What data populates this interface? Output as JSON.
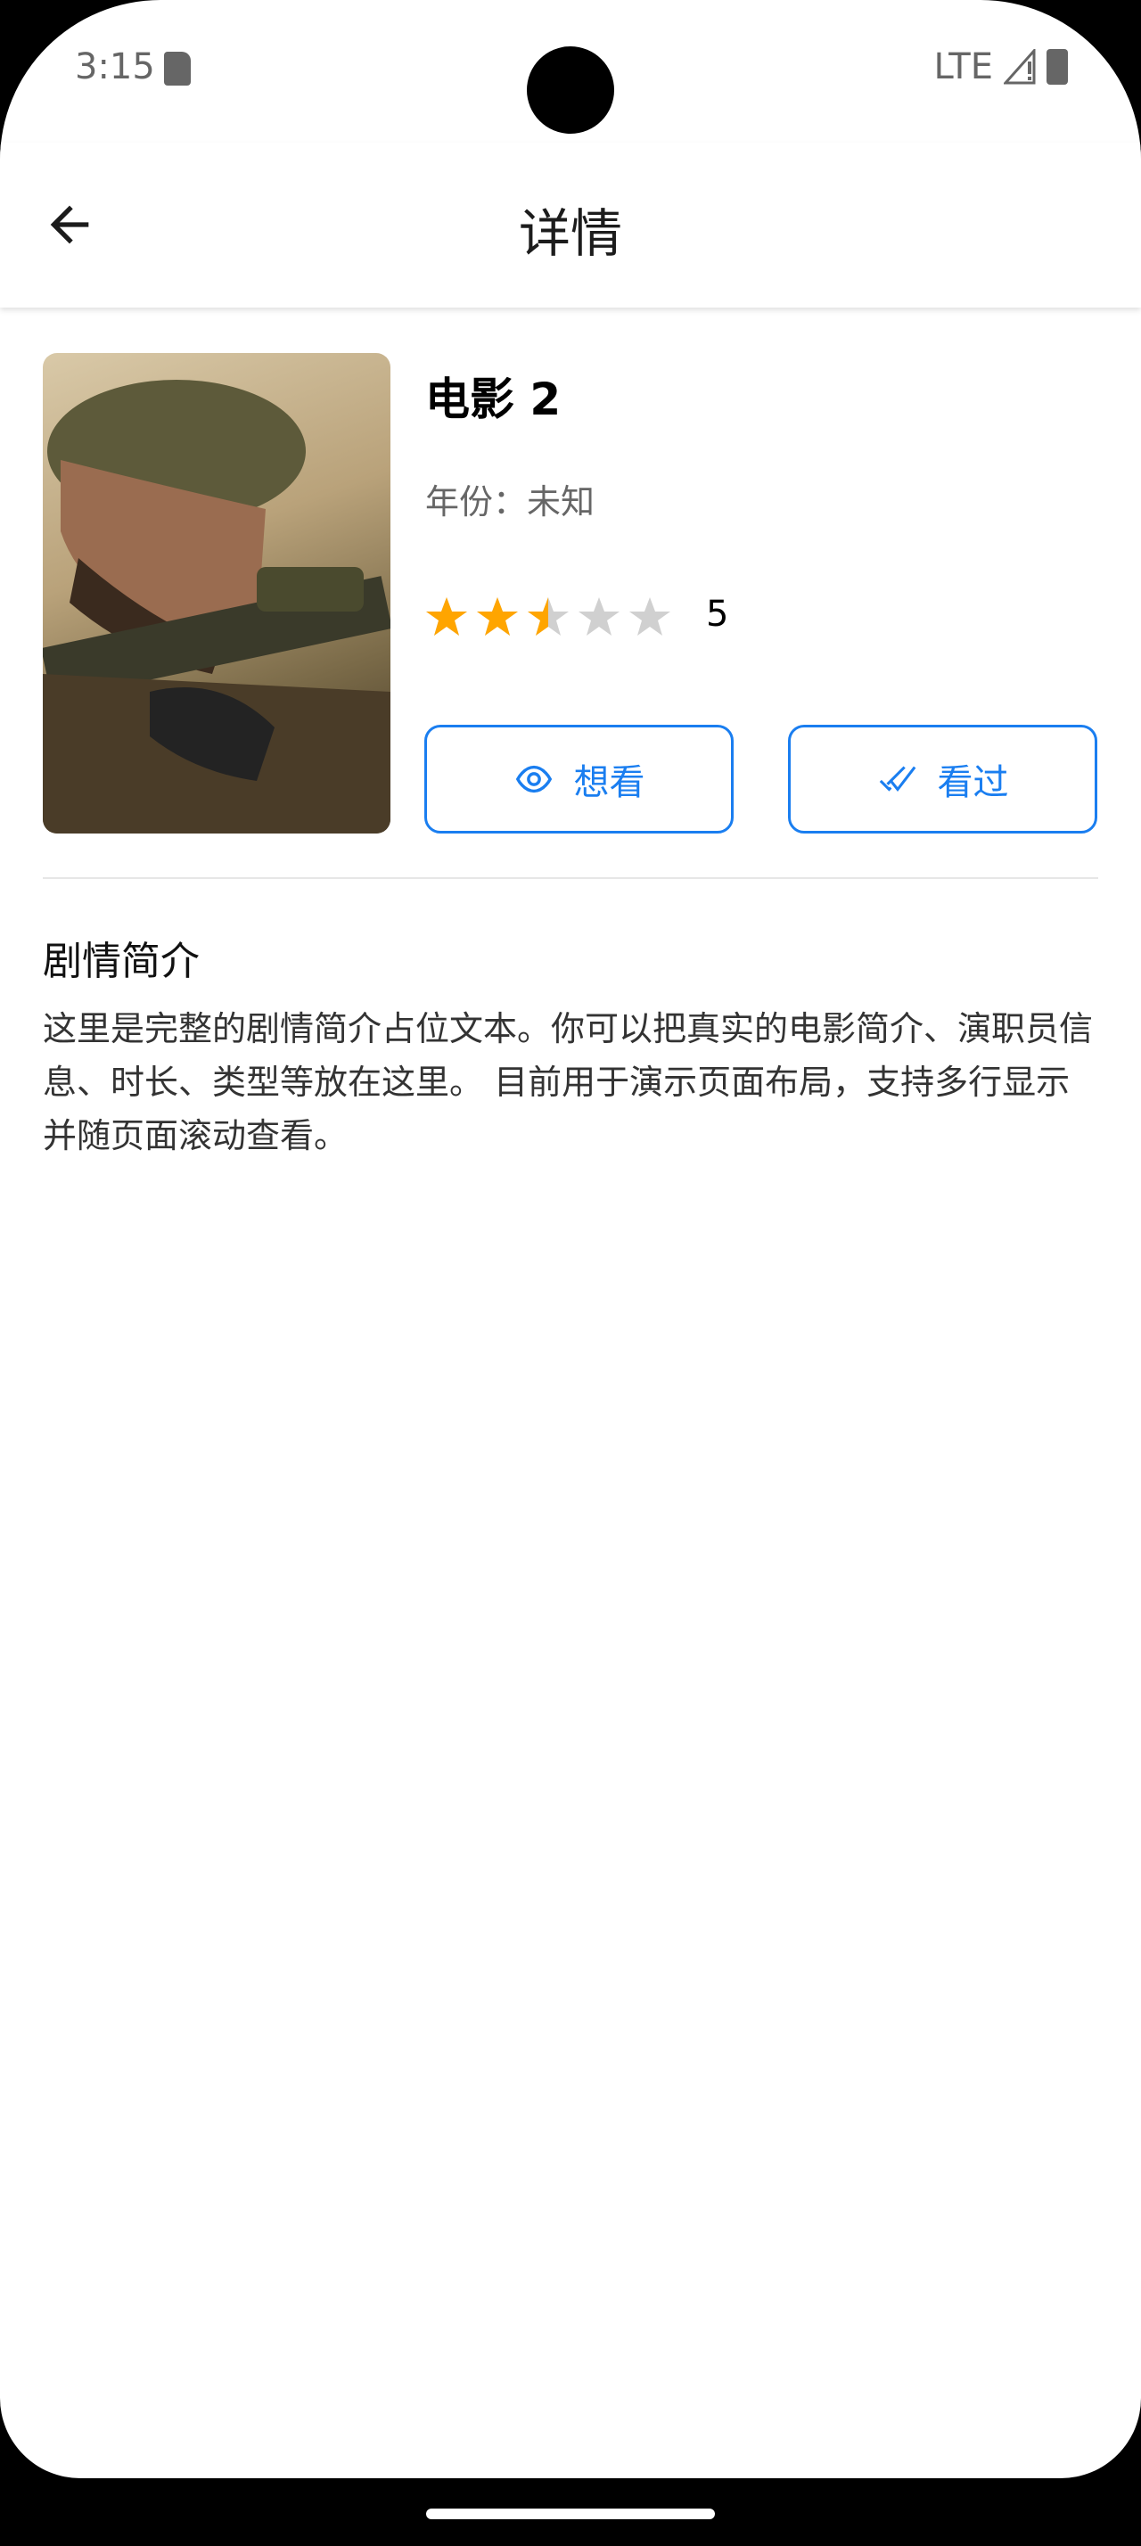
{
  "status_bar": {
    "time": "3:15",
    "network": "LTE"
  },
  "app_bar": {
    "title": "详情",
    "back_icon": "arrow-left-icon"
  },
  "movie": {
    "title": "电影 2",
    "year_text": "年份：未知",
    "rating_stars": 2.5,
    "rating_max": 5,
    "rating_label": "5",
    "colors": {
      "star_filled": "#FFA500",
      "star_empty": "#D0D0D0",
      "accent": "#1A7EF0"
    }
  },
  "actions": {
    "want_label": "想看",
    "want_icon": "eye-icon",
    "watched_label": "看过",
    "watched_icon": "double-check-icon"
  },
  "synopsis": {
    "heading": "剧情简介",
    "text": "这里是完整的剧情简介占位文本。你可以把真实的电影简介、演职员信息、时长、类型等放在这里。 目前用于演示页面布局，支持多行显示并随页面滚动查看。"
  }
}
